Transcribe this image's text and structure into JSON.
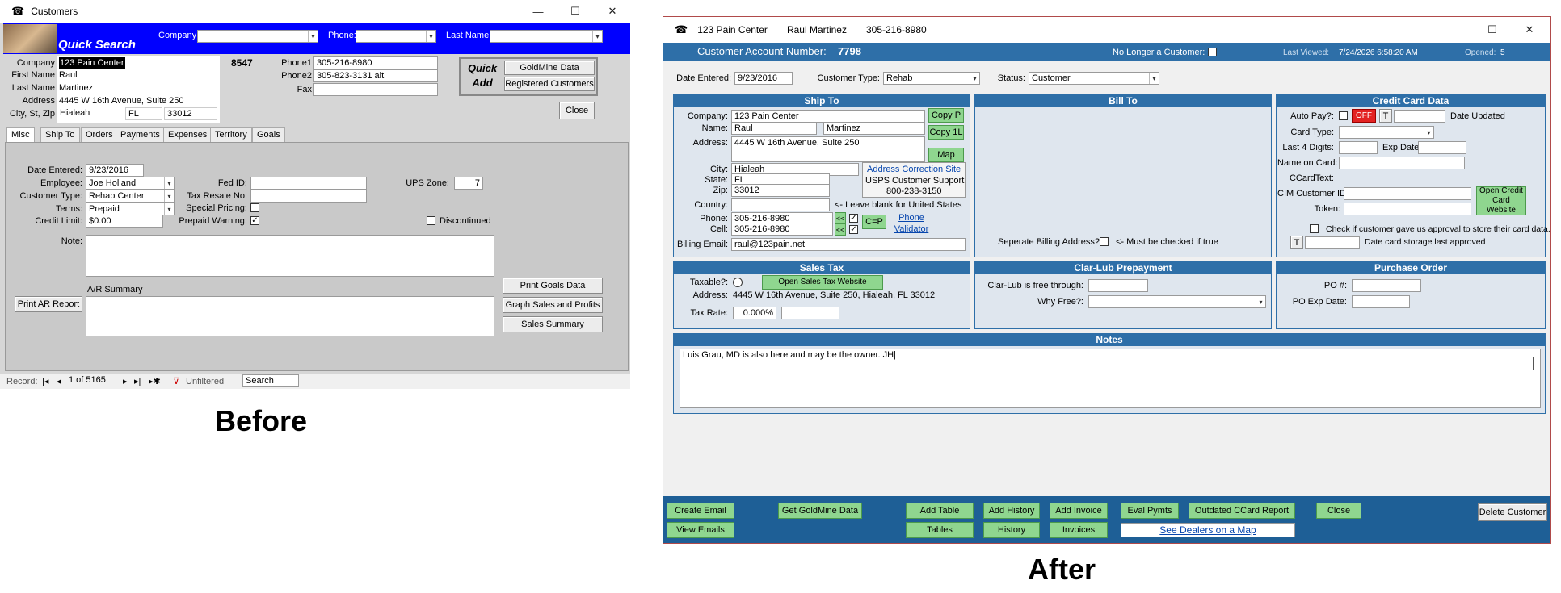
{
  "captions": {
    "before": "Before",
    "after": "After"
  },
  "before": {
    "window_title": "Customers",
    "quick_search": "Quick Search",
    "qs_company_label": "Company:",
    "qs_phone_label": "Phone:",
    "qs_lastname_label": "Last Name:",
    "company_label": "Company",
    "company": "123 Pain Center",
    "first_label": "First Name",
    "first": "Raul",
    "last_label": "Last Name",
    "last": "Martinez",
    "address_label": "Address",
    "address": "4445 W 16th Avenue, Suite 250",
    "csz_label": "City, St, Zip",
    "city": "Hialeah",
    "state": "FL",
    "zip": "33012",
    "account": "8547",
    "phone1_label": "Phone1",
    "phone1": "305-216-8980",
    "phone2_label": "Phone2",
    "phone2": "305-823-3131 alt",
    "fax_label": "Fax",
    "fax": "",
    "quick_add": "Quick Add",
    "goldmine_btn": "GoldMine Data",
    "registered_btn": "Registered Customers",
    "close_btn": "Close",
    "tabs": [
      "Misc",
      "Ship To",
      "Orders",
      "Payments",
      "Expenses",
      "Territory",
      "Goals"
    ],
    "date_entered_label": "Date Entered:",
    "date_entered": "9/23/2016",
    "employee_label": "Employee:",
    "employee": "Joe Holland",
    "ctype_label": "Customer Type:",
    "ctype": "Rehab Center",
    "terms_label": "Terms:",
    "terms": "Prepaid",
    "credit_label": "Credit Limit:",
    "credit": "$0.00",
    "fedid_label": "Fed ID:",
    "taxresale_label": "Tax Resale No:",
    "special_label": "Special Pricing:",
    "prepaid_label": "Prepaid Warning:",
    "ups_label": "UPS Zone:",
    "ups": "7",
    "discontinued_label": "Discontinued",
    "note_label": "Note:",
    "ar_summary_label": "A/R Summary",
    "print_ar_btn": "Print AR Report",
    "print_goals_btn": "Print Goals Data",
    "graph_btn": "Graph Sales and Profits",
    "sales_summary_btn": "Sales Summary",
    "record_label": "Record:",
    "record": "1 of 5165",
    "unfiltered": "Unfiltered",
    "search": "Search"
  },
  "after": {
    "title_company": "123 Pain Center",
    "title_name": "Raul Martinez",
    "title_phone": "305-216-8980",
    "acct_label": "Customer Account Number:",
    "acct": "7798",
    "no_longer_label": "No Longer a Customer:",
    "last_viewed_label": "Last Viewed:",
    "last_viewed": "7/24/2026 6:58:20 AM",
    "opened_label": "Opened:",
    "opened": "5",
    "date_entered_label": "Date Entered:",
    "date_entered": "9/23/2016",
    "ctype_label": "Customer Type:",
    "ctype": "Rehab",
    "status_label": "Status:",
    "status": "Customer",
    "ship_to": "Ship To",
    "bill_to": "Bill To",
    "credit_card": "Credit Card Data",
    "company_label": "Company:",
    "company": "123 Pain Center",
    "name_label": "Name:",
    "first": "Raul",
    "last": "Martinez",
    "address_label": "Address:",
    "address": "4445 W 16th Avenue, Suite 250",
    "copyp_btn": "Copy P",
    "copy1l_btn": "Copy 1L",
    "map_btn": "Map",
    "city_label": "City:",
    "city": "Hialeah",
    "state_label": "State:",
    "state": "FL",
    "zip_label": "Zip:",
    "zip": "33012",
    "addr_correction": "Address Correction Site",
    "usps_support": "USPS Customer Support",
    "usps_phone": "800-238-3150",
    "country_label": "Country:",
    "country_hint": "<- Leave blank for United States",
    "phone_label": "Phone:",
    "phone": "305-216-8980",
    "cell_label": "Cell:",
    "cell": "305-216-8980",
    "arrow_btn": "<<",
    "cp_btn": "C=P",
    "phone_validator": "Phone Validator",
    "billing_email_label": "Billing Email:",
    "billing_email": "raul@123pain.net",
    "separate_billing_label": "Seperate Billing Address?",
    "separate_hint": "<- Must be checked if true",
    "autopay_label": "Auto Pay?:",
    "off_btn": "OFF",
    "t_btn": "T",
    "date_updated": "Date Updated",
    "card_type_label": "Card Type:",
    "last4_label": "Last 4 Digits:",
    "exp_label": "Exp Date:",
    "name_on_card_label": "Name on Card:",
    "ccardtext_label": "CCardText:",
    "cim_label": "CIM Customer ID:",
    "token_label": "Token:",
    "open_credit_btn": "Open Credit Card Website",
    "approval_label": "Check if customer gave us approval to store their card data.",
    "storage_label": "Date card storage last approved",
    "sales_tax": "Sales Tax",
    "clar_lub": "Clar-Lub Prepayment",
    "purchase_order": "Purchase Order",
    "taxable_label": "Taxable?:",
    "open_sales_tax_btn": "Open Sales Tax Website",
    "tax_address_label": "Address:",
    "tax_address": "4445 W 16th Avenue, Suite 250, Hialeah, FL 33012",
    "tax_rate_label": "Tax Rate:",
    "tax_rate": "0.000%",
    "clar_free_label": "Clar-Lub is free through:",
    "why_free_label": "Why Free?:",
    "po_label": "PO #:",
    "po_exp_label": "PO Exp Date:",
    "notes": "Notes",
    "notes_text": "Luis Grau, MD is also here and may be the owner. JH",
    "create_email": "Create Email",
    "view_emails": "View Emails",
    "get_goldmine": "Get GoldMine Data",
    "add_table": "Add Table",
    "tables": "Tables",
    "add_history": "Add History",
    "history": "History",
    "add_invoice": "Add Invoice",
    "invoices": "Invoices",
    "eval_pymts": "Eval Pymts",
    "outdated_ccard": "Outdated CCard Report",
    "close": "Close",
    "see_dealers": "See Dealers on a Map",
    "delete_customer": "Delete Customer"
  },
  "colors": {
    "access_blue": "#0000ff",
    "header_blue": "#2e6fa8",
    "green_btn": "#8fd68f",
    "red_off": "#e32222"
  }
}
